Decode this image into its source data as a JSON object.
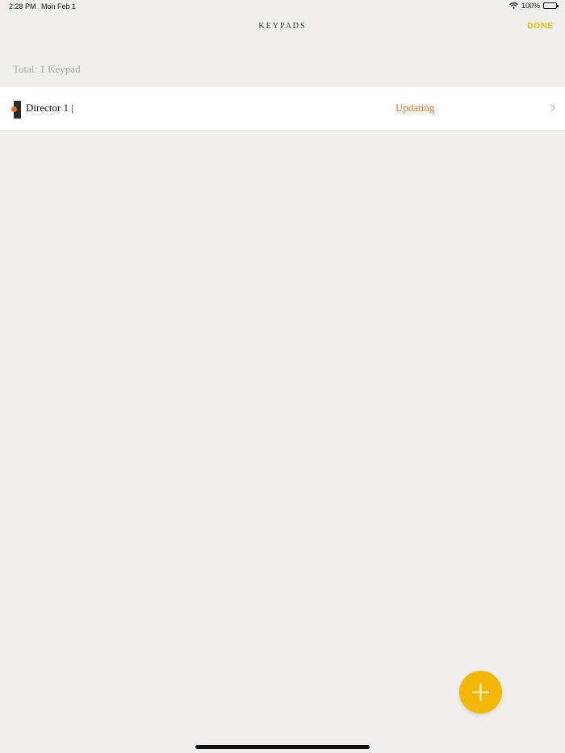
{
  "status_bar": {
    "time": "2:28 PM",
    "date": "Mon Feb 1",
    "battery_percent": "100%",
    "icons": [
      "wifi-icon",
      "battery-icon"
    ]
  },
  "header": {
    "title": "KEYPADS",
    "done_label": "DONE"
  },
  "summary": {
    "total_label": "Total: 1 Keypad"
  },
  "keypads": [
    {
      "name": "Director 1 |",
      "status": "Updating",
      "icon": "keypad-icon",
      "status_color": "#e8702a"
    }
  ],
  "fab": {
    "icon": "plus-icon",
    "color": "#f2b707"
  },
  "colors": {
    "accent": "#f2b707",
    "status": "#e8702a",
    "background": "#f0efed"
  }
}
